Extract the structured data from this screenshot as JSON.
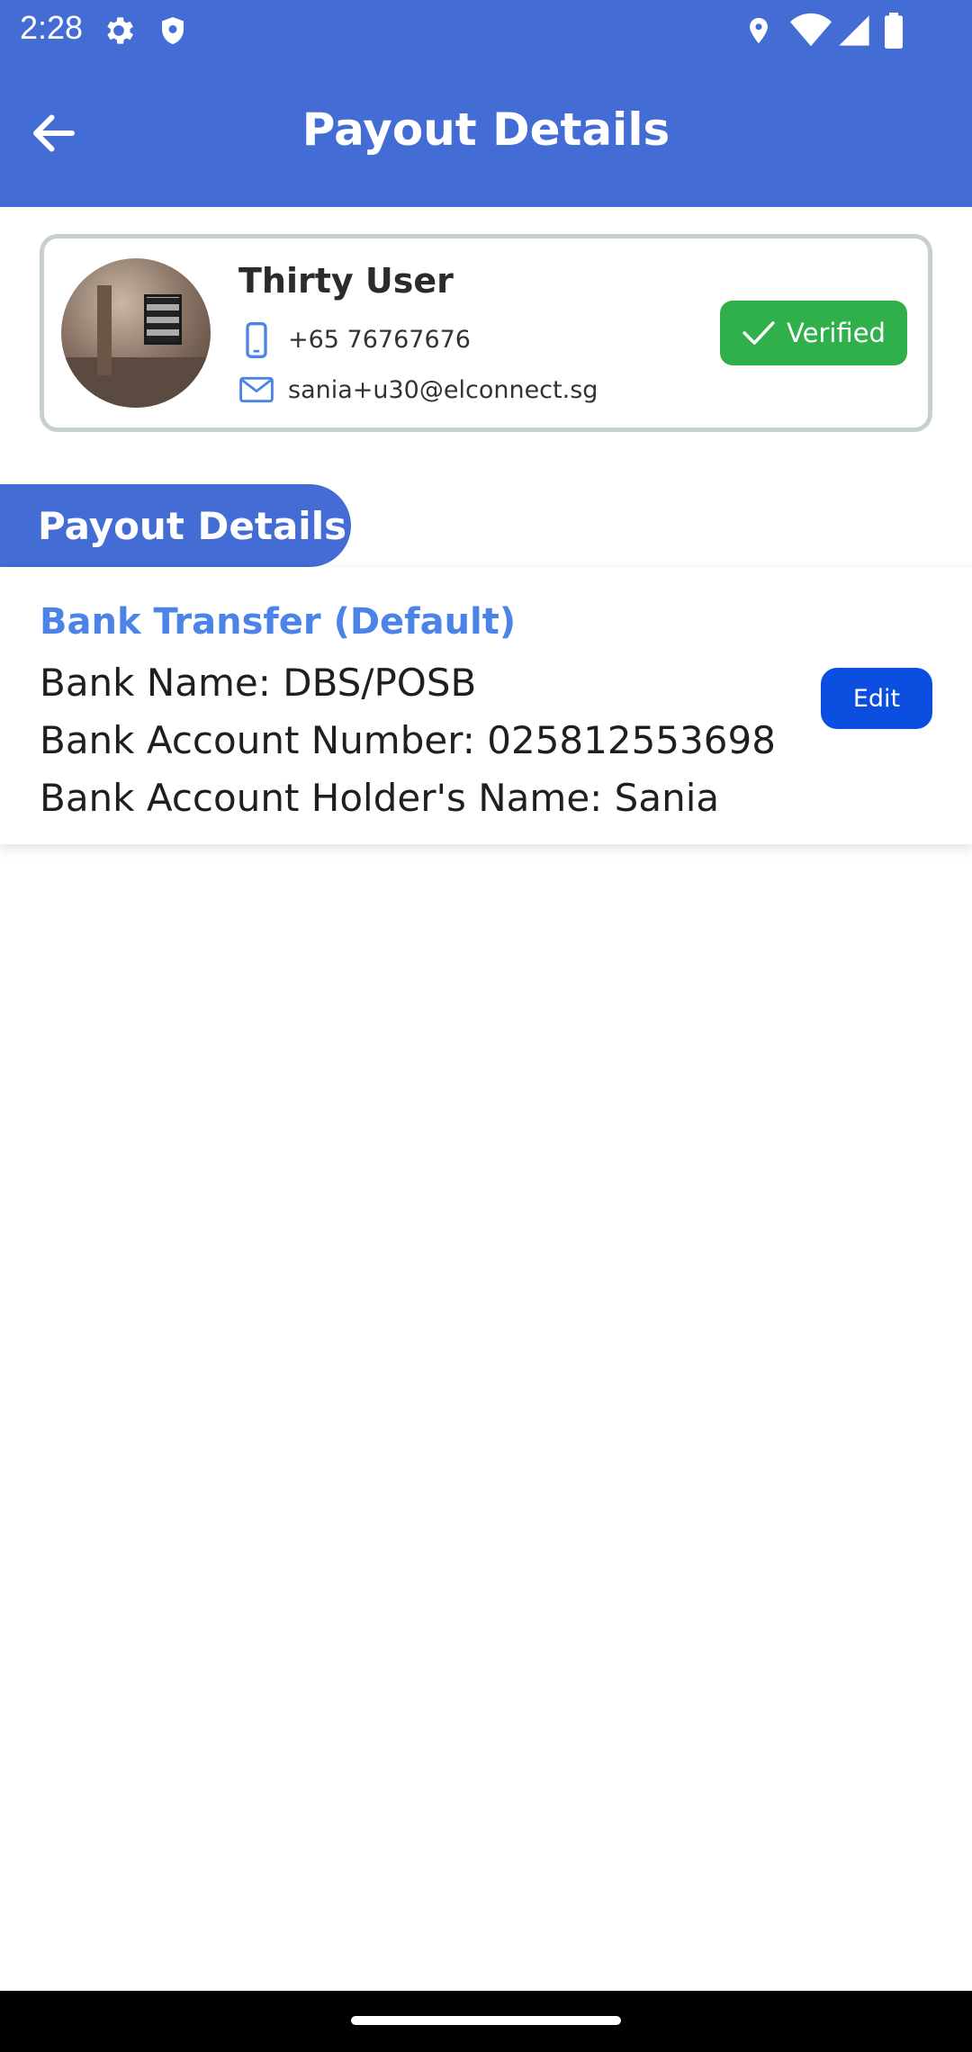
{
  "status_bar": {
    "time": "2:28",
    "icons": [
      "settings-gear-icon",
      "shield-icon",
      "location-pin-icon",
      "wifi-icon",
      "cell-signal-icon",
      "battery-icon"
    ]
  },
  "app_bar": {
    "title": "Payout Details",
    "back_icon": "arrow-left-icon",
    "background_color": "#436dd4"
  },
  "profile": {
    "name": "Thirty User",
    "phone": "+65 76767676",
    "email": "sania+u30@elconnect.sg",
    "verified_label": "Verified",
    "verified_color": "#2fb04b"
  },
  "section": {
    "tab_label": "Payout Details"
  },
  "payout_method": {
    "title": "Bank Transfer (Default)",
    "bank_name": "Bank Name: DBS/POSB",
    "account_number": "Bank Account Number: 025812553698",
    "holder_name": "Bank Account Holder's Name: Sania",
    "edit_label": "Edit",
    "accent_color": "#4b83e6",
    "edit_color": "#0b4ee0"
  }
}
